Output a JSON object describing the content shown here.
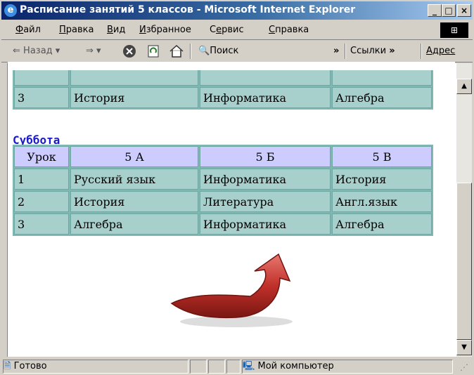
{
  "window": {
    "title": "Расписание занятий 5 классов - Microsoft Internet Explorer",
    "buttons": [
      "_",
      "□",
      "×"
    ]
  },
  "menu": [
    {
      "ul": "Ф",
      "rest": "айл"
    },
    {
      "ul": "П",
      "rest": "равка"
    },
    {
      "ul": "В",
      "rest": "ид"
    },
    {
      "ul": "И",
      "rest": "збранное"
    },
    {
      "pre": "С",
      "ul": "е",
      "rest": "рвис"
    },
    {
      "ul": "С",
      "rest": "правка"
    }
  ],
  "toolbar": {
    "back": "Назад",
    "search": "Поиск",
    "links": "Ссылки",
    "address": "Адрес",
    "back_icon": "back-arrow-icon",
    "forward_icon": "forward-arrow-icon",
    "stop_icon": "stop-icon",
    "refresh_icon": "refresh-icon",
    "home_icon": "home-icon",
    "search_icon": "search-icon"
  },
  "prev_table": {
    "row": [
      "3",
      "История",
      "Информатика",
      "Алгебра"
    ]
  },
  "saturday": {
    "title": "Суббота",
    "headers": [
      "Урок",
      "5 А",
      "5 Б",
      "5 В"
    ],
    "rows": [
      [
        "1",
        "Русский язык",
        "Информатика",
        "История"
      ],
      [
        "2",
        "История",
        "Литература",
        "Англ.язык"
      ],
      [
        "3",
        "Алгебра",
        "Информатика",
        "Алгебра"
      ]
    ]
  },
  "status": {
    "text": "Готово",
    "zone": "Мой компьютер"
  },
  "colors": {
    "header_cell": "#ccccff",
    "body_cell": "#a7cfcc",
    "title": "#1a1ad0",
    "arrow": "#c0302a"
  }
}
